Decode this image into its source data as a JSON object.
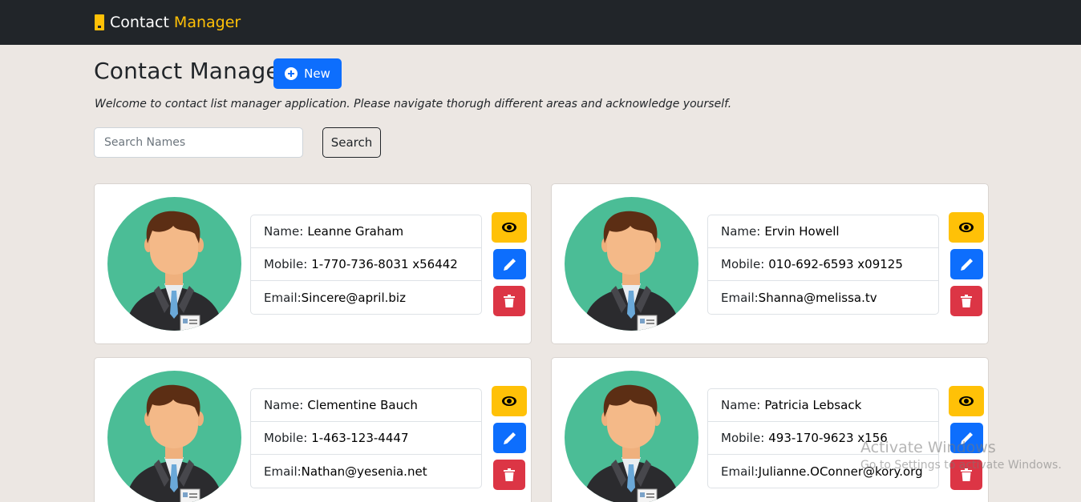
{
  "navbar": {
    "brand_main": "Contact",
    "brand_accent": "Manager"
  },
  "header": {
    "title": "Contact Manager",
    "new_label": "New"
  },
  "welcome_text": "Welcome to contact list manager application. Please navigate thorugh different areas and acknowledge yourself.",
  "search": {
    "placeholder": "Search Names",
    "value": "",
    "button_label": "Search"
  },
  "labels": {
    "name": "Name:",
    "mobile": "Mobile:",
    "email": "Email:"
  },
  "contacts": [
    {
      "name": "Leanne Graham",
      "mobile": "1-770-736-8031 x56442",
      "email": "Sincere@april.biz"
    },
    {
      "name": "Ervin Howell",
      "mobile": "010-692-6593 x09125",
      "email": "Shanna@melissa.tv"
    },
    {
      "name": "Clementine Bauch",
      "mobile": "1-463-123-4447",
      "email": "Nathan@yesenia.net"
    },
    {
      "name": "Patricia Lebsack",
      "mobile": "493-170-9623 x156",
      "email": "Julianne.OConner@kory.org"
    }
  ],
  "icons": {
    "brand": "contact-card-icon",
    "new": "plus-circle-icon",
    "view": "eye-icon",
    "edit": "pencil-icon",
    "delete": "trash-icon"
  },
  "colors": {
    "navbar": "#212529",
    "accent": "#ffc107",
    "primary": "#0d6efd",
    "danger": "#dc3545",
    "avatar_bg": "#4bbd96",
    "page_bg": "#ece7e3"
  },
  "os_watermark": {
    "line1": "Activate Windows",
    "line2": "Go to Settings to activate Windows."
  }
}
